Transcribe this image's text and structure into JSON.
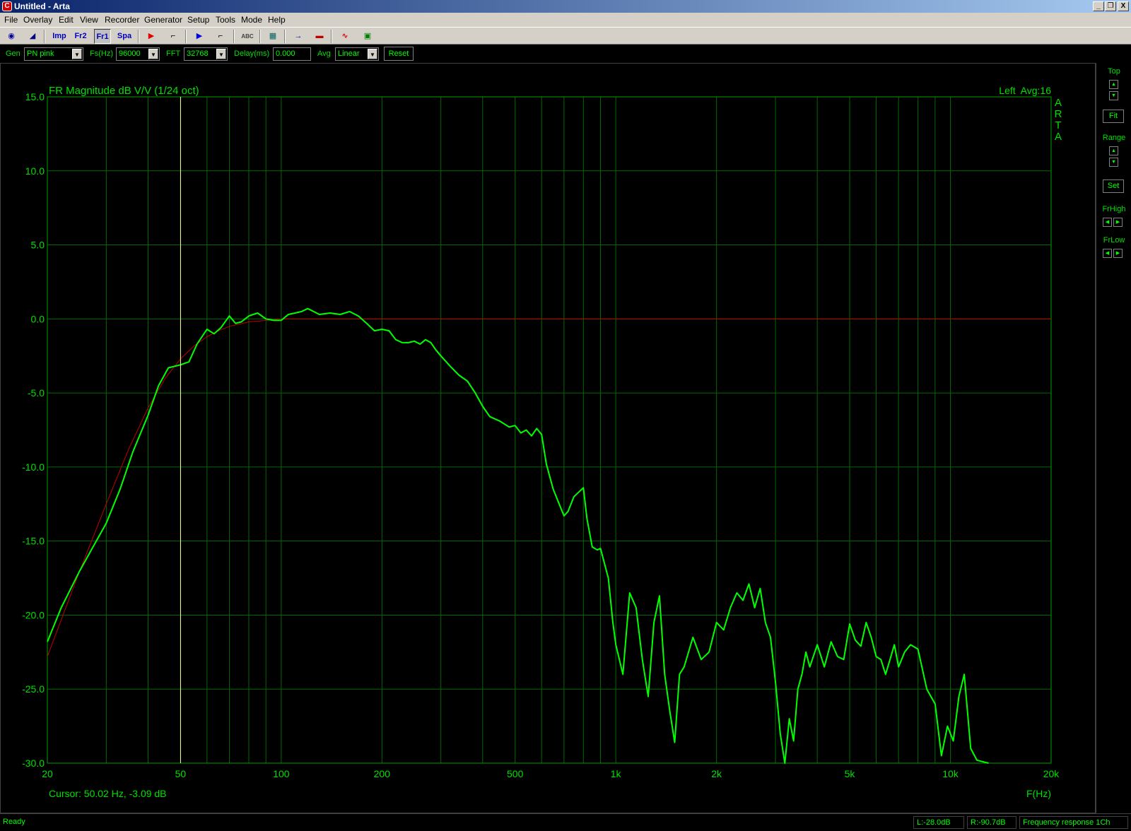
{
  "window": {
    "title": "Untitled - Arta",
    "icon": "arta-app-icon",
    "icon_glyph": "C",
    "minimize": "_",
    "restore": "❐",
    "close": "X"
  },
  "menu": [
    "File",
    "Overlay",
    "Edit",
    "View",
    "Recorder",
    "Generator",
    "Setup",
    "Tools",
    "Mode",
    "Help"
  ],
  "toolbar": {
    "buttons": [
      {
        "name": "record-icon",
        "glyph": "◉",
        "color": "#0000a0"
      },
      {
        "name": "waveform-icon",
        "glyph": "◢",
        "color": "#000080"
      },
      {
        "name": "imp-mode-button",
        "glyph": "Imp",
        "color": "#0000c0"
      },
      {
        "name": "fr2-mode-button",
        "glyph": "Fr2",
        "color": "#0000c0"
      },
      {
        "name": "fr1-mode-button",
        "glyph": "Fr1",
        "color": "#0000c0"
      },
      {
        "name": "spa-mode-button",
        "glyph": "Spa",
        "color": "#0000c0"
      },
      {
        "name": "play-red-icon",
        "glyph": "▶",
        "color": "#e00000"
      },
      {
        "name": "stop-icon",
        "glyph": "⌐",
        "color": "#000000"
      },
      {
        "name": "play-blue-icon",
        "glyph": "▶",
        "color": "#0000e0"
      },
      {
        "name": "stop-blue-icon",
        "glyph": "⌐",
        "color": "#000000"
      },
      {
        "name": "abc-icon",
        "glyph": "ABC",
        "color": "#404040"
      },
      {
        "name": "grid-icon",
        "glyph": "▦",
        "color": "#006060"
      },
      {
        "name": "arrow-right-icon",
        "glyph": "→",
        "color": "#0000c0"
      },
      {
        "name": "overlay-icon",
        "glyph": "▬",
        "color": "#c00000"
      },
      {
        "name": "sine-icon",
        "glyph": "∿",
        "color": "#e00000"
      },
      {
        "name": "scope-icon",
        "glyph": "▣",
        "color": "#008000"
      }
    ]
  },
  "controls": {
    "gen_label": "Gen",
    "gen_value": "PN pink",
    "fs_label": "Fs(Hz)",
    "fs_value": "96000",
    "fft_label": "FFT",
    "fft_value": "32768",
    "delay_label": "Delay(ms)",
    "delay_value": "0.000",
    "avg_label": "Avg",
    "avg_value": "Linear",
    "reset_label": "Reset",
    "dropdown_glyph": "▼"
  },
  "side": {
    "top_label": "Top",
    "fit_label": "Fit",
    "range_label": "Range",
    "set_label": "Set",
    "frhigh_label": "FrHigh",
    "frlow_label": "FrLow",
    "up_glyph": "▲",
    "down_glyph": "▼",
    "left_glyph": "◀",
    "right_glyph": "▶"
  },
  "plot": {
    "title": "FR Magnitude dB V/V (1/24 oct)",
    "channel": "Left  Avg:16",
    "logo": "ARTA",
    "cursor_text": "Cursor: 50.02 Hz, -3.09 dB",
    "xlabel": "F(Hz)"
  },
  "chart_data": {
    "type": "line",
    "title": "FR Magnitude dB V/V (1/24 oct)",
    "xlabel": "F(Hz)",
    "ylabel": "",
    "xscale": "log",
    "xlim": [
      20,
      20000
    ],
    "ylim": [
      -30,
      15
    ],
    "grid": true,
    "y_ticks": [
      "15.0",
      "10.0",
      "5.0",
      "0.0",
      "-5.0",
      "-10.0",
      "-15.0",
      "-20.0",
      "-25.0",
      "-30.0"
    ],
    "x_ticks": [
      {
        "v": 20,
        "label": "20"
      },
      {
        "v": 50,
        "label": "50"
      },
      {
        "v": 100,
        "label": "100"
      },
      {
        "v": 200,
        "label": "200"
      },
      {
        "v": 500,
        "label": "500"
      },
      {
        "v": 1000,
        "label": "1k"
      },
      {
        "v": 2000,
        "label": "2k"
      },
      {
        "v": 5000,
        "label": "5k"
      },
      {
        "v": 10000,
        "label": "10k"
      },
      {
        "v": 20000,
        "label": "20k"
      }
    ],
    "cursor_freq": 50.02,
    "series": [
      {
        "color": "#00ff00",
        "x": [
          20,
          22,
          25,
          28,
          30,
          33,
          36,
          40,
          43,
          46,
          50,
          53,
          56,
          60,
          63,
          66,
          70,
          73,
          76,
          80,
          85,
          90,
          95,
          100,
          105,
          110,
          115,
          120,
          125,
          130,
          140,
          150,
          160,
          170,
          180,
          190,
          200,
          210,
          220,
          230,
          240,
          250,
          260,
          270,
          280,
          290,
          300,
          320,
          340,
          360,
          380,
          400,
          420,
          450,
          480,
          500,
          520,
          540,
          560,
          580,
          600,
          620,
          650,
          680,
          700,
          720,
          750,
          800,
          820,
          850,
          880,
          900,
          950,
          980,
          1000,
          1050,
          1100,
          1150,
          1200,
          1250,
          1300,
          1350,
          1400,
          1450,
          1500,
          1550,
          1600,
          1700,
          1800,
          1900,
          2000,
          2100,
          2200,
          2300,
          2400,
          2500,
          2600,
          2700,
          2800,
          2900,
          3000,
          3100,
          3200,
          3300,
          3400,
          3500,
          3600,
          3700,
          3800,
          4000,
          4200,
          4400,
          4600,
          4800,
          5000,
          5200,
          5400,
          5600,
          5800,
          6000,
          6200,
          6400,
          6600,
          6800,
          7000,
          7300,
          7600,
          8000,
          8500,
          9000,
          9400,
          9800,
          10200,
          10600,
          11000,
          11500,
          12000,
          13000
        ],
        "y": [
          -21.8,
          -19.5,
          -17.0,
          -15.0,
          -13.8,
          -11.5,
          -9.0,
          -6.5,
          -4.5,
          -3.3,
          -3.1,
          -2.9,
          -1.7,
          -0.7,
          -1.0,
          -0.6,
          0.2,
          -0.3,
          -0.2,
          0.2,
          0.4,
          0.0,
          -0.1,
          -0.1,
          0.3,
          0.4,
          0.5,
          0.7,
          0.5,
          0.3,
          0.4,
          0.3,
          0.5,
          0.2,
          -0.3,
          -0.8,
          -0.7,
          -0.8,
          -1.4,
          -1.6,
          -1.6,
          -1.5,
          -1.7,
          -1.4,
          -1.6,
          -2.1,
          -2.5,
          -3.2,
          -3.8,
          -4.2,
          -5.0,
          -5.9,
          -6.6,
          -6.9,
          -7.3,
          -7.2,
          -7.7,
          -7.5,
          -7.9,
          -7.4,
          -7.8,
          -9.8,
          -11.5,
          -12.6,
          -13.3,
          -13.0,
          -12.0,
          -11.4,
          -13.5,
          -15.4,
          -15.6,
          -15.5,
          -17.5,
          -20.5,
          -22.0,
          -24.0,
          -18.5,
          -19.5,
          -23.0,
          -25.5,
          -20.5,
          -18.7,
          -24.0,
          -26.5,
          -28.6,
          -24.0,
          -23.5,
          -21.5,
          -23.0,
          -22.5,
          -20.5,
          -21.0,
          -19.5,
          -18.5,
          -19.0,
          -17.9,
          -19.5,
          -18.2,
          -20.5,
          -21.5,
          -24.5,
          -28.0,
          -30.0,
          -27.0,
          -28.5,
          -25.0,
          -24.0,
          -22.5,
          -23.5,
          -22.0,
          -23.5,
          -21.8,
          -22.8,
          -23.0,
          -20.6,
          -21.7,
          -22.1,
          -20.5,
          -21.5,
          -22.8,
          -23.0,
          -24.0,
          -23.0,
          -22.0,
          -23.5,
          -22.5,
          -22.0,
          -22.3,
          -25.0,
          -26.0,
          -29.5,
          -27.5,
          -28.5,
          -25.5,
          -24.0,
          -29.0,
          -29.8,
          -30.0
        ]
      },
      {
        "color": "#c00000",
        "x": [
          20,
          25,
          30,
          35,
          40,
          45,
          50,
          55,
          60,
          65,
          70,
          80,
          90,
          100,
          120,
          150,
          200,
          300,
          500,
          1000,
          2000,
          5000,
          10000,
          20000
        ],
        "y": [
          -22.8,
          -17.0,
          -12.5,
          -8.8,
          -6.0,
          -4.0,
          -2.7,
          -1.8,
          -1.2,
          -0.8,
          -0.5,
          -0.2,
          -0.1,
          0,
          0,
          0,
          0,
          0,
          0,
          0,
          0,
          0,
          0,
          0
        ]
      }
    ]
  },
  "status": {
    "ready": "Ready",
    "left_level": "L:-28.0dB",
    "right_level": "R:-90.7dB",
    "mode": "Frequency response 1Ch"
  }
}
